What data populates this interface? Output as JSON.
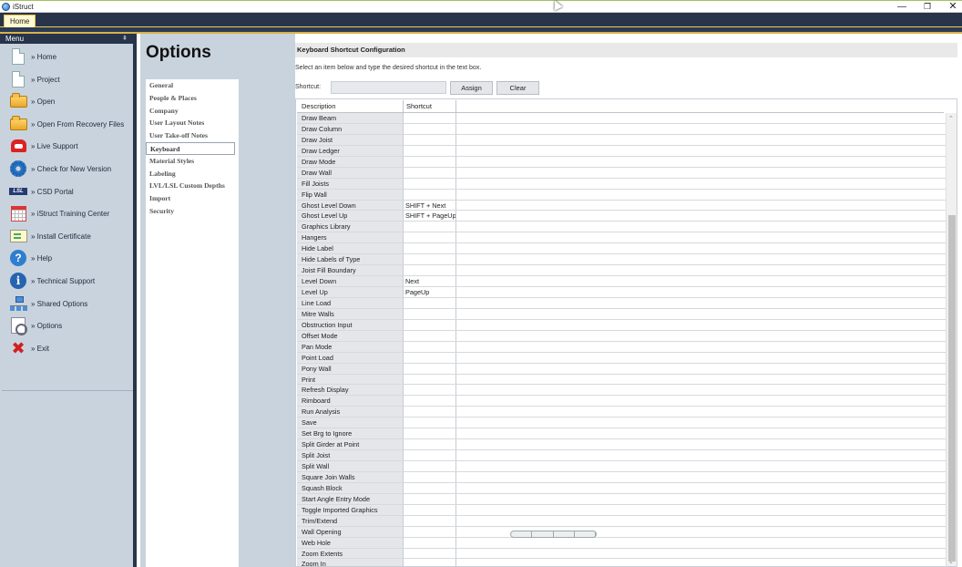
{
  "window": {
    "title": "iStruct",
    "minimize": "—",
    "restore": "❐",
    "close": "✕"
  },
  "ribbon": {
    "tabs": [
      "Home"
    ]
  },
  "sidebar": {
    "header": "Menu",
    "pin": "⇞",
    "items": [
      {
        "label": "» Home",
        "icon": "document-icon"
      },
      {
        "label": "» Project",
        "icon": "document-icon"
      },
      {
        "label": "» Open",
        "icon": "folder-icon"
      },
      {
        "label": "» Open From Recovery Files",
        "icon": "folder-icon"
      },
      {
        "label": "» Live Support",
        "icon": "phone-icon"
      },
      {
        "label": "» Check for New Version",
        "icon": "gear-icon"
      },
      {
        "label": "» CSD Portal",
        "icon": "csd-logo-icon"
      },
      {
        "label": "» iStruct Training Center",
        "icon": "calendar-icon"
      },
      {
        "label": "» Install Certificate",
        "icon": "certificate-icon"
      },
      {
        "label": "» Help",
        "icon": "help-icon"
      },
      {
        "label": "» Technical Support",
        "icon": "info-icon"
      },
      {
        "label": "» Shared Options",
        "icon": "network-icon"
      },
      {
        "label": "» Options",
        "icon": "options-icon"
      },
      {
        "label": "» Exit",
        "icon": "exit-icon"
      }
    ]
  },
  "options": {
    "title": "Options",
    "nav": [
      "General",
      "People & Places",
      "Company",
      "User Layout Notes",
      "User Take-off Notes",
      "Keyboard",
      "Material Styles",
      "Labeling",
      "LVL/LSL Custom Depths",
      "Import",
      "Security"
    ],
    "selected": "Keyboard"
  },
  "keyboard": {
    "heading": "Keyboard Shortcut Configuration",
    "instruction": "Select an item below and type the desired shortcut in the text box.",
    "shortcut_label": "Shortcut:",
    "shortcut_value": "",
    "assign_label": "Assign",
    "clear_label": "Clear",
    "columns": [
      "Description",
      "Shortcut"
    ],
    "rows": [
      {
        "description": "Draw Beam",
        "shortcut": ""
      },
      {
        "description": "Draw Column",
        "shortcut": ""
      },
      {
        "description": "Draw Joist",
        "shortcut": ""
      },
      {
        "description": "Draw Ledger",
        "shortcut": ""
      },
      {
        "description": "Draw Mode",
        "shortcut": ""
      },
      {
        "description": "Draw Wall",
        "shortcut": ""
      },
      {
        "description": "Fill Joists",
        "shortcut": ""
      },
      {
        "description": "Flip Wall",
        "shortcut": ""
      },
      {
        "description": "Ghost Level Down",
        "shortcut": "SHIFT + Next"
      },
      {
        "description": "Ghost Level Up",
        "shortcut": "SHIFT + PageUp"
      },
      {
        "description": "Graphics Library",
        "shortcut": ""
      },
      {
        "description": "Hangers",
        "shortcut": ""
      },
      {
        "description": "Hide Label",
        "shortcut": ""
      },
      {
        "description": "Hide Labels of Type",
        "shortcut": ""
      },
      {
        "description": "Joist Fill Boundary",
        "shortcut": ""
      },
      {
        "description": "Level Down",
        "shortcut": "Next"
      },
      {
        "description": "Level Up",
        "shortcut": "PageUp"
      },
      {
        "description": "Line Load",
        "shortcut": ""
      },
      {
        "description": "Mitre Walls",
        "shortcut": ""
      },
      {
        "description": "Obstruction Input",
        "shortcut": ""
      },
      {
        "description": "Offset Mode",
        "shortcut": ""
      },
      {
        "description": "Pan Mode",
        "shortcut": ""
      },
      {
        "description": "Point Load",
        "shortcut": ""
      },
      {
        "description": "Pony Wall",
        "shortcut": ""
      },
      {
        "description": "Print",
        "shortcut": ""
      },
      {
        "description": "Refresh Display",
        "shortcut": ""
      },
      {
        "description": "Rimboard",
        "shortcut": ""
      },
      {
        "description": "Run Analysis",
        "shortcut": ""
      },
      {
        "description": "Save",
        "shortcut": ""
      },
      {
        "description": "Set Brg to Ignore",
        "shortcut": ""
      },
      {
        "description": "Split Girder at Point",
        "shortcut": ""
      },
      {
        "description": "Split Joist",
        "shortcut": ""
      },
      {
        "description": "Split Wall",
        "shortcut": ""
      },
      {
        "description": "Square Join Walls",
        "shortcut": ""
      },
      {
        "description": "Squash Block",
        "shortcut": ""
      },
      {
        "description": "Start Angle Entry Mode",
        "shortcut": ""
      },
      {
        "description": "Toggle Imported Graphics",
        "shortcut": ""
      },
      {
        "description": "Trim/Extend",
        "shortcut": ""
      },
      {
        "description": "Wall Opening",
        "shortcut": ""
      },
      {
        "description": "Web Hole",
        "shortcut": ""
      },
      {
        "description": "Zoom Extents",
        "shortcut": ""
      },
      {
        "description": "Zoom In",
        "shortcut": ""
      }
    ]
  },
  "colors": {
    "sidebar_bg": "#c9d3de",
    "ribbon_bg": "#27344a",
    "accent": "#f2c94c"
  }
}
